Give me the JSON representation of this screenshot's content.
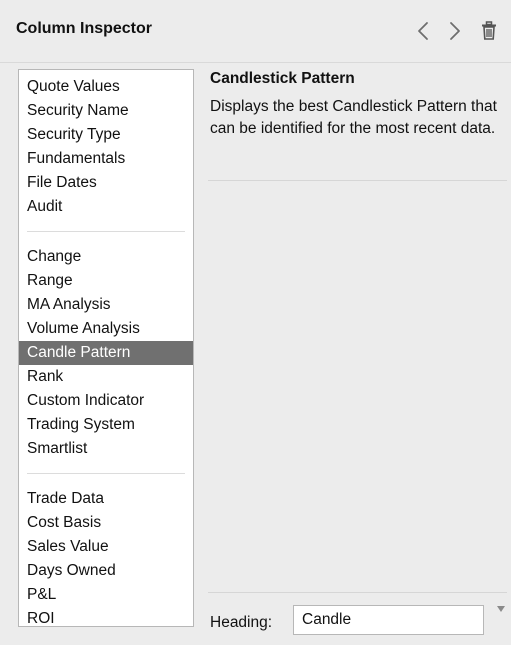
{
  "header": {
    "title": "Column Inspector",
    "icons": [
      "chevron-left-icon",
      "chevron-right-icon",
      "trash-icon"
    ]
  },
  "list": {
    "groups": [
      [
        "Quote Values",
        "Security Name",
        "Security Type",
        "Fundamentals",
        "File Dates",
        "Audit"
      ],
      [
        "Change",
        "Range",
        "MA Analysis",
        "Volume Analysis",
        "Candle Pattern",
        "Rank",
        "Custom Indicator",
        "Trading System",
        "Smartlist"
      ],
      [
        "Trade Data",
        "Cost Basis",
        "Sales Value",
        "Days Owned",
        "P&L",
        "ROI"
      ]
    ],
    "selected": "Candle Pattern"
  },
  "detail": {
    "title": "Candlestick Pattern",
    "description": "Displays the best Candlestick Pattern that can be identified for the most recent data."
  },
  "heading": {
    "label": "Heading:",
    "value": "Candle"
  },
  "colors": {
    "background": "#ececec",
    "selected": "#707070",
    "icon": "#6e6e6e"
  }
}
